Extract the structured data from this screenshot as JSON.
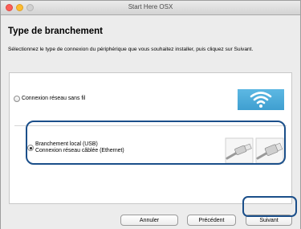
{
  "window": {
    "title": "Start Here OSX"
  },
  "page": {
    "heading": "Type de branchement",
    "instructions": "Sélectionnez le type de connexion du périphérique que vous souhaitez installer, puis cliquez sur Suivant."
  },
  "options": [
    {
      "label": "Connexion réseau sans fil",
      "selected": false,
      "icon": "wifi-icon"
    },
    {
      "label_line1": "Branchement local (USB)",
      "label_line2": "Connexion réseau câblée (Ethernet)",
      "selected": true,
      "icon": "cable-connectors-icon"
    }
  ],
  "buttons": {
    "cancel": "Annuler",
    "previous": "Précédent",
    "next": "Suivant"
  },
  "colors": {
    "highlight": "#1b4f8a",
    "wifi_background": "#4aa8d8"
  }
}
